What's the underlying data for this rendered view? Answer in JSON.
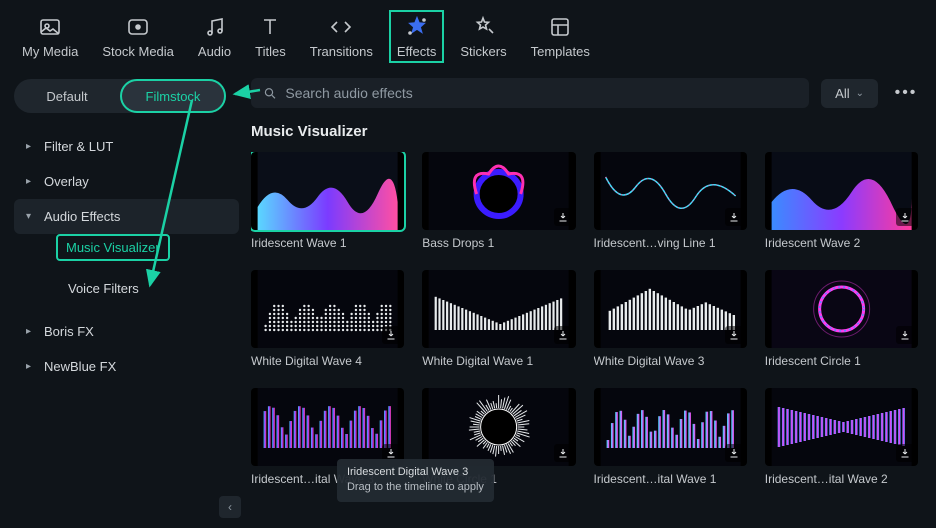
{
  "top_tabs": [
    {
      "key": "my-media",
      "label": "My Media"
    },
    {
      "key": "stock-media",
      "label": "Stock Media"
    },
    {
      "key": "audio",
      "label": "Audio"
    },
    {
      "key": "titles",
      "label": "Titles"
    },
    {
      "key": "transitions",
      "label": "Transitions"
    },
    {
      "key": "effects",
      "label": "Effects",
      "active": true
    },
    {
      "key": "stickers",
      "label": "Stickers"
    },
    {
      "key": "templates",
      "label": "Templates"
    }
  ],
  "segmented": {
    "default_label": "Default",
    "filmstock_label": "Filmstock"
  },
  "tree": {
    "items": [
      {
        "label": "Filter & LUT",
        "expanded": false
      },
      {
        "label": "Overlay",
        "expanded": false
      },
      {
        "label": "Audio Effects",
        "expanded": true,
        "children": [
          {
            "label": "Music Visualizer",
            "active": true
          },
          {
            "label": "Voice Filters",
            "active": false
          }
        ]
      },
      {
        "label": "Boris FX",
        "expanded": false
      },
      {
        "label": "NewBlue FX",
        "expanded": false
      }
    ]
  },
  "search": {
    "placeholder": "Search audio effects"
  },
  "filter": {
    "label": "All"
  },
  "section_title": "Music Visualizer",
  "effects": [
    {
      "label": "Iridescent Wave 1",
      "style": "grad-wave",
      "selected": true,
      "dl": false
    },
    {
      "label": "Bass Drops 1",
      "style": "bass-drops",
      "dl": true
    },
    {
      "label": "Iridescent…ving Line 1",
      "style": "thin-line",
      "dl": true
    },
    {
      "label": "Iridescent Wave 2",
      "style": "grad-wave-2",
      "dl": true
    },
    {
      "label": "White  Digital Wave 4",
      "style": "dots-bars",
      "dl": true
    },
    {
      "label": "White Digital Wave 1",
      "style": "v-bars",
      "dl": true
    },
    {
      "label": "White Digital Wave 3",
      "style": "tri-bars",
      "dl": true
    },
    {
      "label": "Iridescent Circle 1",
      "style": "neon-circle",
      "dl": true
    },
    {
      "label": "Iridescent…ital Wave 3",
      "style": "grad-bars",
      "dl": true
    },
    {
      "label": "White Circle 1",
      "style": "white-circle",
      "dl": true
    },
    {
      "label": "Iridescent…ital Wave 1",
      "style": "grad-bars-2",
      "dl": true
    },
    {
      "label": "Iridescent…ital Wave 2",
      "style": "grad-bars-3",
      "dl": true
    }
  ],
  "tooltip": {
    "title": "Iridescent Digital Wave 3",
    "hint": "Drag to the timeline to apply"
  }
}
